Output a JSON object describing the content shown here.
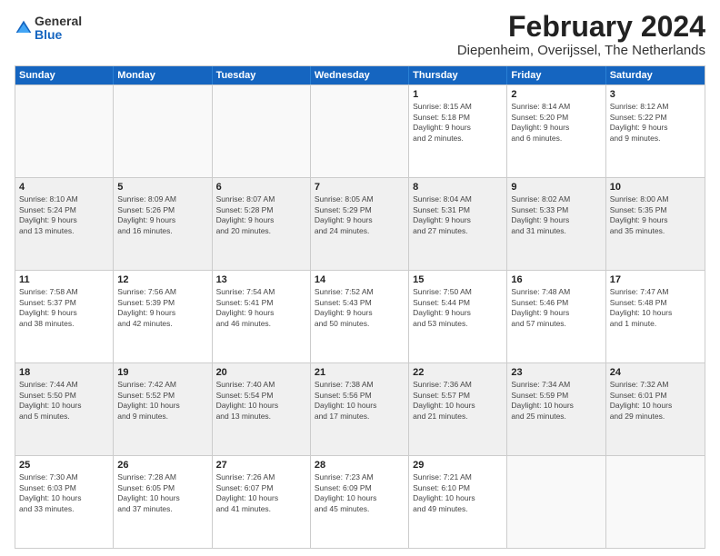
{
  "logo": {
    "general": "General",
    "blue": "Blue"
  },
  "header": {
    "title": "February 2024",
    "subtitle": "Diepenheim, Overijssel, The Netherlands"
  },
  "weekdays": [
    "Sunday",
    "Monday",
    "Tuesday",
    "Wednesday",
    "Thursday",
    "Friday",
    "Saturday"
  ],
  "rows": [
    [
      {
        "day": "",
        "info": "",
        "empty": true
      },
      {
        "day": "",
        "info": "",
        "empty": true
      },
      {
        "day": "",
        "info": "",
        "empty": true
      },
      {
        "day": "",
        "info": "",
        "empty": true
      },
      {
        "day": "1",
        "info": "Sunrise: 8:15 AM\nSunset: 5:18 PM\nDaylight: 9 hours\nand 2 minutes."
      },
      {
        "day": "2",
        "info": "Sunrise: 8:14 AM\nSunset: 5:20 PM\nDaylight: 9 hours\nand 6 minutes."
      },
      {
        "day": "3",
        "info": "Sunrise: 8:12 AM\nSunset: 5:22 PM\nDaylight: 9 hours\nand 9 minutes."
      }
    ],
    [
      {
        "day": "4",
        "info": "Sunrise: 8:10 AM\nSunset: 5:24 PM\nDaylight: 9 hours\nand 13 minutes.",
        "shaded": true
      },
      {
        "day": "5",
        "info": "Sunrise: 8:09 AM\nSunset: 5:26 PM\nDaylight: 9 hours\nand 16 minutes.",
        "shaded": true
      },
      {
        "day": "6",
        "info": "Sunrise: 8:07 AM\nSunset: 5:28 PM\nDaylight: 9 hours\nand 20 minutes.",
        "shaded": true
      },
      {
        "day": "7",
        "info": "Sunrise: 8:05 AM\nSunset: 5:29 PM\nDaylight: 9 hours\nand 24 minutes.",
        "shaded": true
      },
      {
        "day": "8",
        "info": "Sunrise: 8:04 AM\nSunset: 5:31 PM\nDaylight: 9 hours\nand 27 minutes.",
        "shaded": true
      },
      {
        "day": "9",
        "info": "Sunrise: 8:02 AM\nSunset: 5:33 PM\nDaylight: 9 hours\nand 31 minutes.",
        "shaded": true
      },
      {
        "day": "10",
        "info": "Sunrise: 8:00 AM\nSunset: 5:35 PM\nDaylight: 9 hours\nand 35 minutes.",
        "shaded": true
      }
    ],
    [
      {
        "day": "11",
        "info": "Sunrise: 7:58 AM\nSunset: 5:37 PM\nDaylight: 9 hours\nand 38 minutes."
      },
      {
        "day": "12",
        "info": "Sunrise: 7:56 AM\nSunset: 5:39 PM\nDaylight: 9 hours\nand 42 minutes."
      },
      {
        "day": "13",
        "info": "Sunrise: 7:54 AM\nSunset: 5:41 PM\nDaylight: 9 hours\nand 46 minutes."
      },
      {
        "day": "14",
        "info": "Sunrise: 7:52 AM\nSunset: 5:43 PM\nDaylight: 9 hours\nand 50 minutes."
      },
      {
        "day": "15",
        "info": "Sunrise: 7:50 AM\nSunset: 5:44 PM\nDaylight: 9 hours\nand 53 minutes."
      },
      {
        "day": "16",
        "info": "Sunrise: 7:48 AM\nSunset: 5:46 PM\nDaylight: 9 hours\nand 57 minutes."
      },
      {
        "day": "17",
        "info": "Sunrise: 7:47 AM\nSunset: 5:48 PM\nDaylight: 10 hours\nand 1 minute."
      }
    ],
    [
      {
        "day": "18",
        "info": "Sunrise: 7:44 AM\nSunset: 5:50 PM\nDaylight: 10 hours\nand 5 minutes.",
        "shaded": true
      },
      {
        "day": "19",
        "info": "Sunrise: 7:42 AM\nSunset: 5:52 PM\nDaylight: 10 hours\nand 9 minutes.",
        "shaded": true
      },
      {
        "day": "20",
        "info": "Sunrise: 7:40 AM\nSunset: 5:54 PM\nDaylight: 10 hours\nand 13 minutes.",
        "shaded": true
      },
      {
        "day": "21",
        "info": "Sunrise: 7:38 AM\nSunset: 5:56 PM\nDaylight: 10 hours\nand 17 minutes.",
        "shaded": true
      },
      {
        "day": "22",
        "info": "Sunrise: 7:36 AM\nSunset: 5:57 PM\nDaylight: 10 hours\nand 21 minutes.",
        "shaded": true
      },
      {
        "day": "23",
        "info": "Sunrise: 7:34 AM\nSunset: 5:59 PM\nDaylight: 10 hours\nand 25 minutes.",
        "shaded": true
      },
      {
        "day": "24",
        "info": "Sunrise: 7:32 AM\nSunset: 6:01 PM\nDaylight: 10 hours\nand 29 minutes.",
        "shaded": true
      }
    ],
    [
      {
        "day": "25",
        "info": "Sunrise: 7:30 AM\nSunset: 6:03 PM\nDaylight: 10 hours\nand 33 minutes."
      },
      {
        "day": "26",
        "info": "Sunrise: 7:28 AM\nSunset: 6:05 PM\nDaylight: 10 hours\nand 37 minutes."
      },
      {
        "day": "27",
        "info": "Sunrise: 7:26 AM\nSunset: 6:07 PM\nDaylight: 10 hours\nand 41 minutes."
      },
      {
        "day": "28",
        "info": "Sunrise: 7:23 AM\nSunset: 6:09 PM\nDaylight: 10 hours\nand 45 minutes."
      },
      {
        "day": "29",
        "info": "Sunrise: 7:21 AM\nSunset: 6:10 PM\nDaylight: 10 hours\nand 49 minutes."
      },
      {
        "day": "",
        "info": "",
        "empty": true
      },
      {
        "day": "",
        "info": "",
        "empty": true
      }
    ]
  ]
}
